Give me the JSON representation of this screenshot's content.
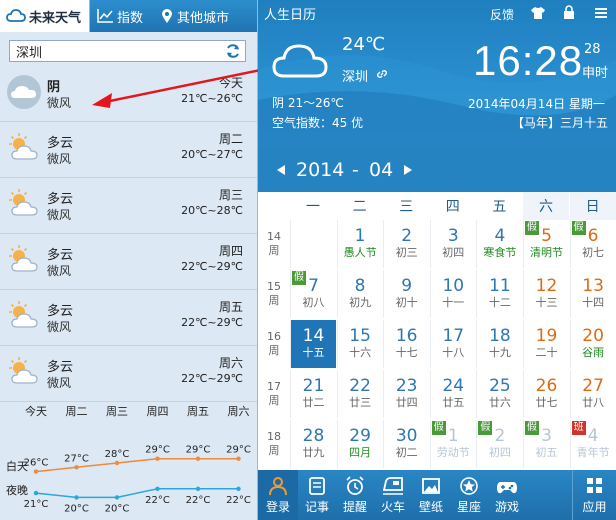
{
  "weather": {
    "tabs": [
      {
        "label": "未来天气",
        "icon": "cloud-icon"
      },
      {
        "label": "指数",
        "icon": "chart-icon"
      },
      {
        "label": "其他城市",
        "icon": "pin-icon"
      }
    ],
    "city": "深圳",
    "days": [
      {
        "name": "今天",
        "condition": "阴",
        "wind": "微风",
        "range": "21℃~26℃",
        "icon": "cloudy-icon"
      },
      {
        "name": "周二",
        "condition": "多云",
        "wind": "微风",
        "range": "20℃~27℃",
        "icon": "partly-cloudy-icon"
      },
      {
        "name": "周三",
        "condition": "多云",
        "wind": "微风",
        "range": "20℃~28℃",
        "icon": "partly-cloudy-icon"
      },
      {
        "name": "周四",
        "condition": "多云",
        "wind": "微风",
        "range": "22℃~29℃",
        "icon": "partly-cloudy-icon"
      },
      {
        "name": "周五",
        "condition": "多云",
        "wind": "微风",
        "range": "22℃~29℃",
        "icon": "partly-cloudy-icon"
      },
      {
        "name": "周六",
        "condition": "多云",
        "wind": "微风",
        "range": "22℃~29℃",
        "icon": "partly-cloudy-icon"
      }
    ],
    "trend": {
      "day_label": "白天",
      "night_label": "夜晚",
      "days": [
        "今天",
        "周二",
        "周三",
        "周四",
        "周五",
        "周六"
      ],
      "day_temps": [
        26,
        27,
        28,
        29,
        29,
        29
      ],
      "night_temps": [
        21,
        20,
        20,
        22,
        22,
        22
      ],
      "day_texts": [
        "26°C",
        "27°C",
        "28°C",
        "29°C",
        "29°C",
        "29°C"
      ],
      "night_texts": [
        "21°C",
        "20°C",
        "20°C",
        "22°C",
        "22°C",
        "22°C"
      ],
      "day_color": "#f08a3c",
      "night_color": "#2aa7de"
    }
  },
  "calendar": {
    "app_title": "人生日历",
    "header_links": {
      "feedback": "反馈"
    },
    "current": {
      "temp": "24℃",
      "city": "深圳",
      "condition": "阴 21～26℃",
      "aqi": "空气指数：45 优"
    },
    "clock": {
      "time": "16:28",
      "seconds": "28",
      "suffix": "时",
      "chinese": "申时"
    },
    "date": {
      "full": "2014年04月14日 星期一",
      "lunar": "【马年】三月十五"
    },
    "nav": {
      "year": "2014",
      "sep": "-",
      "month": "04"
    },
    "weekdays": [
      "一",
      "二",
      "三",
      "四",
      "五",
      "六",
      "日"
    ],
    "week_label": "周",
    "weeks": [
      {
        "week": "14",
        "cells": [
          {
            "d": "",
            "l": "",
            "t": ""
          },
          {
            "d": "1",
            "l": "愚人节",
            "t": "hol"
          },
          {
            "d": "2",
            "l": "初三",
            "t": ""
          },
          {
            "d": "3",
            "l": "初四",
            "t": ""
          },
          {
            "d": "4",
            "l": "寒食节",
            "t": "hol"
          },
          {
            "d": "5",
            "l": "清明节",
            "t": "wend hol",
            "tag": "假"
          },
          {
            "d": "6",
            "l": "初七",
            "t": "wend",
            "tag": "假"
          }
        ]
      },
      {
        "week": "15",
        "cells": [
          {
            "d": "7",
            "l": "初八",
            "t": "",
            "tag": "假"
          },
          {
            "d": "8",
            "l": "初九",
            "t": ""
          },
          {
            "d": "9",
            "l": "初十",
            "t": ""
          },
          {
            "d": "10",
            "l": "十一",
            "t": ""
          },
          {
            "d": "11",
            "l": "十二",
            "t": ""
          },
          {
            "d": "12",
            "l": "十三",
            "t": "wend"
          },
          {
            "d": "13",
            "l": "十四",
            "t": "wend"
          }
        ]
      },
      {
        "week": "16",
        "cells": [
          {
            "d": "14",
            "l": "十五",
            "t": "sel"
          },
          {
            "d": "15",
            "l": "十六",
            "t": ""
          },
          {
            "d": "16",
            "l": "十七",
            "t": ""
          },
          {
            "d": "17",
            "l": "十八",
            "t": ""
          },
          {
            "d": "18",
            "l": "十九",
            "t": ""
          },
          {
            "d": "19",
            "l": "二十",
            "t": "wend"
          },
          {
            "d": "20",
            "l": "谷雨",
            "t": "wend hol"
          }
        ]
      },
      {
        "week": "17",
        "cells": [
          {
            "d": "21",
            "l": "廿二",
            "t": ""
          },
          {
            "d": "22",
            "l": "廿三",
            "t": ""
          },
          {
            "d": "23",
            "l": "廿四",
            "t": ""
          },
          {
            "d": "24",
            "l": "廿五",
            "t": ""
          },
          {
            "d": "25",
            "l": "廿六",
            "t": ""
          },
          {
            "d": "26",
            "l": "廿七",
            "t": "wend"
          },
          {
            "d": "27",
            "l": "廿八",
            "t": "wend"
          }
        ]
      },
      {
        "week": "18",
        "cells": [
          {
            "d": "28",
            "l": "廿九",
            "t": ""
          },
          {
            "d": "29",
            "l": "四月",
            "t": "hol"
          },
          {
            "d": "30",
            "l": "初二",
            "t": ""
          },
          {
            "d": "1",
            "l": "劳动节",
            "t": "other",
            "tag": "假"
          },
          {
            "d": "2",
            "l": "初四",
            "t": "other",
            "tag": "假"
          },
          {
            "d": "3",
            "l": "初五",
            "t": "other",
            "tag": "假"
          },
          {
            "d": "4",
            "l": "青年节",
            "t": "other",
            "tag": "班",
            "tagtype": "ban"
          }
        ]
      }
    ],
    "toolbar": [
      {
        "label": "登录",
        "icon": "user-icon"
      },
      {
        "label": "记事",
        "icon": "note-icon"
      },
      {
        "label": "提醒",
        "icon": "alarm-icon"
      },
      {
        "label": "火车",
        "icon": "train-icon"
      },
      {
        "label": "壁纸",
        "icon": "wallpaper-icon"
      },
      {
        "label": "星座",
        "icon": "star-icon"
      },
      {
        "label": "游戏",
        "icon": "gamepad-icon"
      },
      {
        "label": "应用",
        "icon": "apps-icon"
      }
    ],
    "colors": {
      "accent": "#1f75b5",
      "weekend": "#e06a12",
      "holiday": "#1e8a1e",
      "tag": "#4a9a3a",
      "ban": "#d0352c"
    }
  }
}
